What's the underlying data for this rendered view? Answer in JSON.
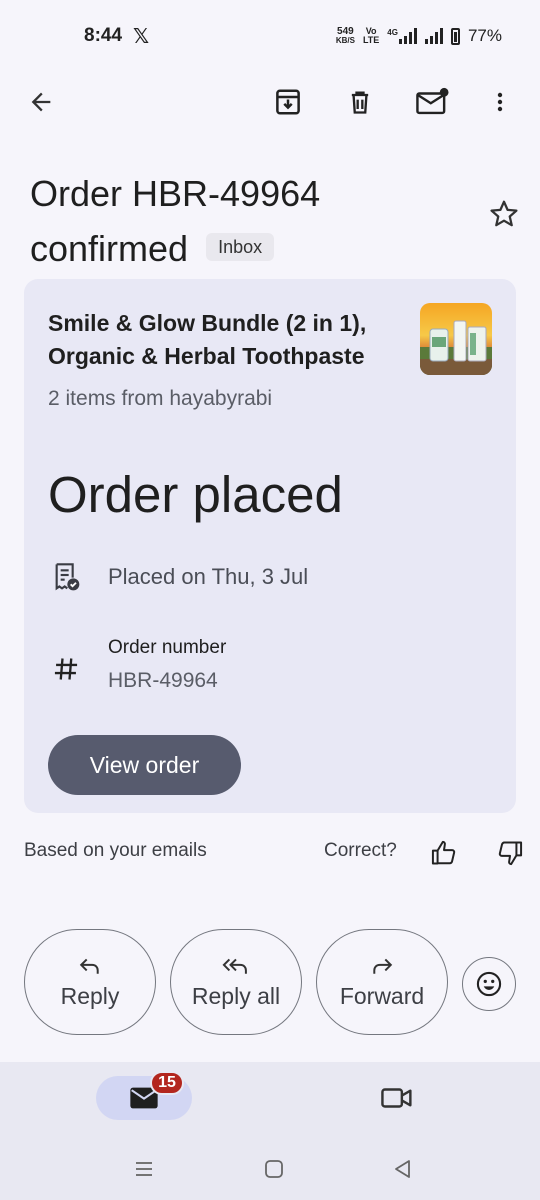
{
  "status_bar": {
    "time": "8:44",
    "x_icon_label": "𝕏",
    "net_speed_value": "549",
    "net_speed_unit": "KB/S",
    "volte_top": "Vo",
    "volte_bottom": "LTE",
    "network": "4G",
    "battery": "77%"
  },
  "toolbar": {
    "icons": [
      "back-arrow-icon",
      "archive-icon",
      "delete-icon",
      "mark-unread-icon",
      "more-vert-icon"
    ]
  },
  "email": {
    "subject": "Order HBR-49964 confirmed",
    "label": "Inbox"
  },
  "order_card": {
    "product_title": "Smile & Glow Bundle (2 in 1), Organic & Herbal Toothpaste",
    "product_subtitle": "2 items from hayabyrabi",
    "status_heading": "Order placed",
    "placed_text": "Placed on Thu, 3 Jul",
    "order_number_label": "Order number",
    "order_number_value": "HBR-49964",
    "view_button": "View order"
  },
  "feedback": {
    "based_text": "Based on your emails",
    "correct_text": "Correct?"
  },
  "actions": {
    "reply": "Reply",
    "reply_all": "Reply all",
    "forward": "Forward"
  },
  "bottom_nav": {
    "mail_badge": "15"
  },
  "colors": {
    "background": "#f6f5fb",
    "card": "#e8e8f5",
    "primary_button": "#575b6e",
    "badge": "#b3261e",
    "nav_active": "#d2d6f3"
  }
}
